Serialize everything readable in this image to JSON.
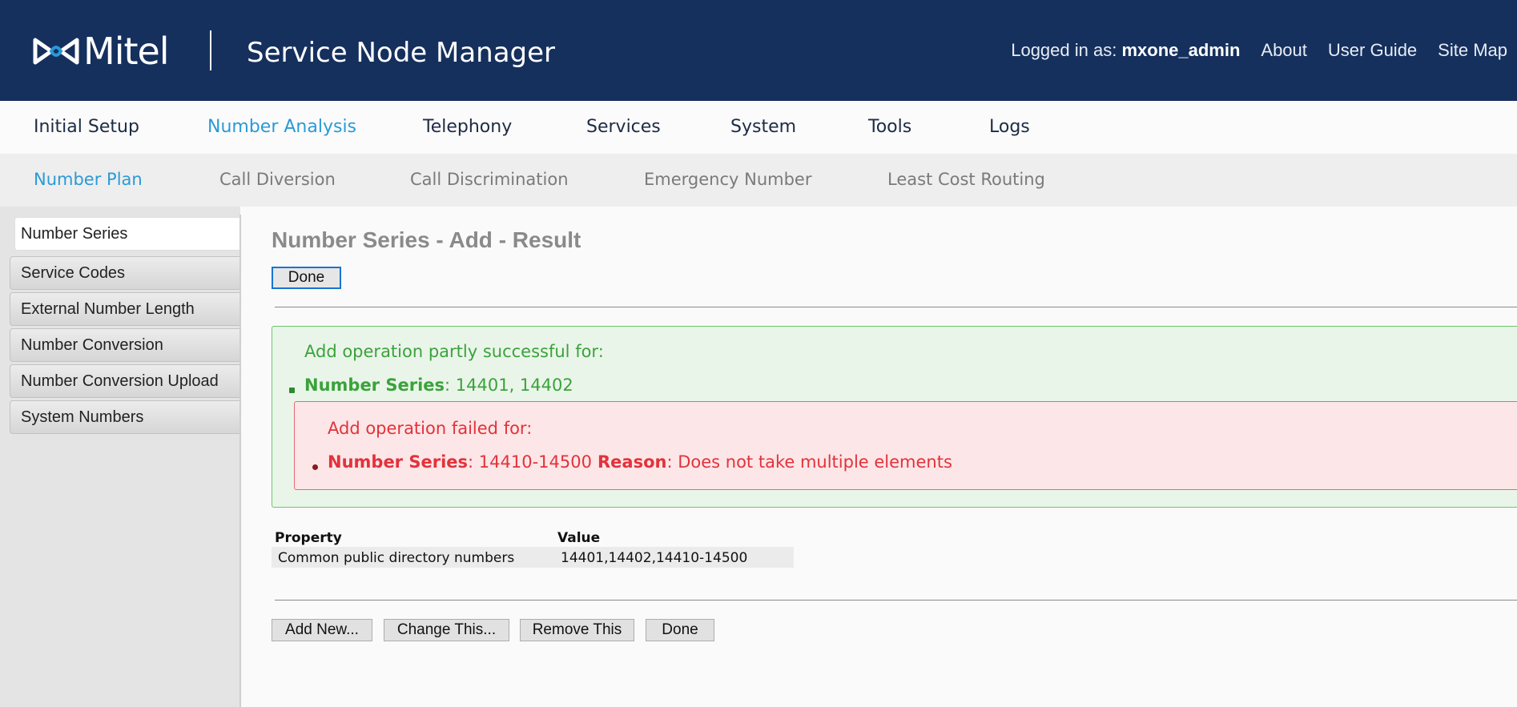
{
  "header": {
    "brand": "Mitel",
    "app_title": "Service Node Manager",
    "logged_in_label": "Logged in as:",
    "logged_in_user": "mxone_admin",
    "links": [
      "About",
      "User Guide",
      "Site Map"
    ],
    "colors": {
      "background": "#15305d",
      "accent": "#2a9ad8"
    }
  },
  "topnav": {
    "items": [
      "Initial Setup",
      "Number Analysis",
      "Telephony",
      "Services",
      "System",
      "Tools",
      "Logs"
    ],
    "active": "Number Analysis"
  },
  "subnav": {
    "items": [
      "Number Plan",
      "Call Diversion",
      "Call Discrimination",
      "Emergency Number",
      "Least Cost Routing"
    ],
    "active": "Number Plan"
  },
  "sidebar": {
    "items": [
      "Number Series",
      "Service Codes",
      "External Number Length",
      "Number Conversion",
      "Number Conversion Upload",
      "System Numbers"
    ],
    "active": "Number Series"
  },
  "main": {
    "title": "Number Series - Add - Result",
    "done_top_label": "Done",
    "success": {
      "title": "Add operation partly successful for:",
      "label": "Number Series",
      "value": ": 14401, 14402",
      "color": "#3aa33a"
    },
    "error": {
      "title": "Add operation failed for:",
      "label": "Number Series",
      "value": ": 14410-14500",
      "reason_label": "Reason",
      "reason_value": ": Does not take multiple elements",
      "color": "#e2323c"
    },
    "table": {
      "headers": [
        "Property",
        "Value"
      ],
      "rows": [
        [
          "Common public directory numbers",
          "14401,14402,14410-14500"
        ]
      ]
    },
    "buttons": [
      "Add New...",
      "Change This...",
      "Remove This",
      "Done"
    ]
  }
}
